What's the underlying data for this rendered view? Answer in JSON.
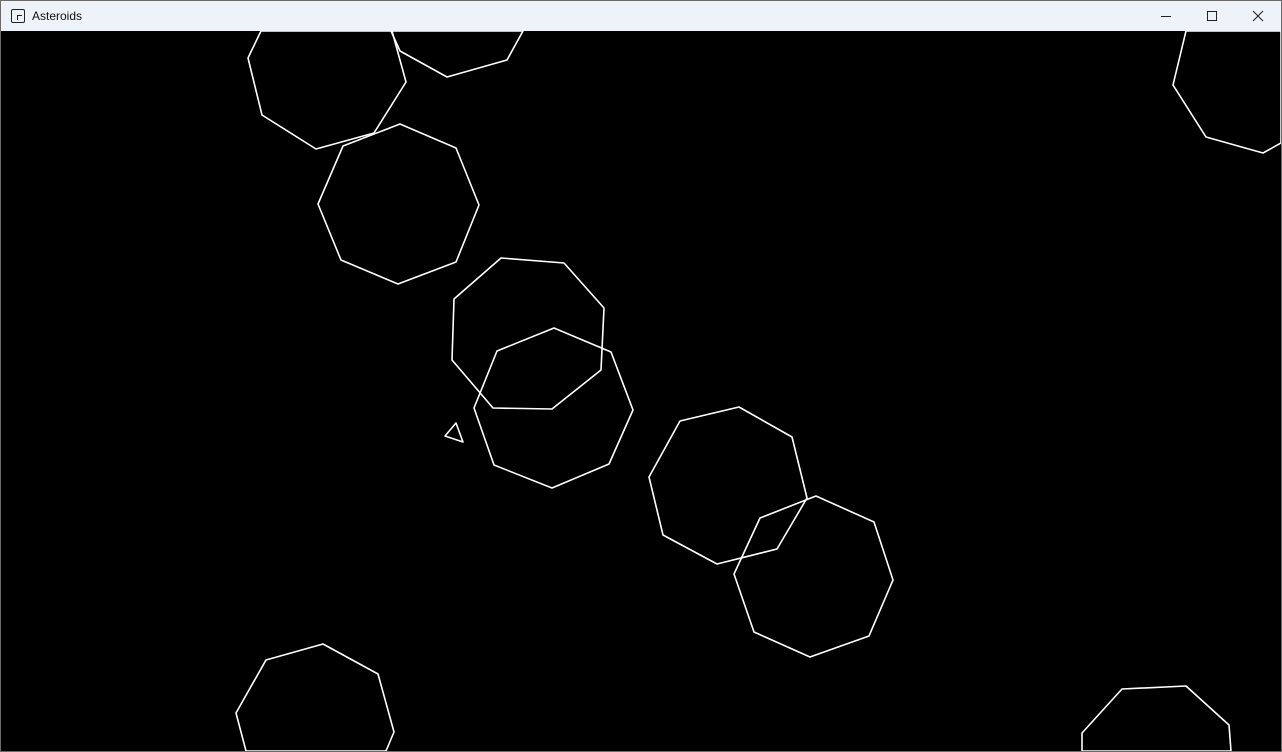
{
  "window": {
    "title": "Asteroids",
    "app_icon": "app-window-icon",
    "controls": {
      "minimize_icon": "minimize-icon",
      "maximize_icon": "maximize-icon",
      "close_icon": "close-icon"
    }
  },
  "game": {
    "background_color": "#000000",
    "stroke_color": "#ffffff",
    "ship_icon": "triangle-ship-icon",
    "asteroid_count": 10
  }
}
